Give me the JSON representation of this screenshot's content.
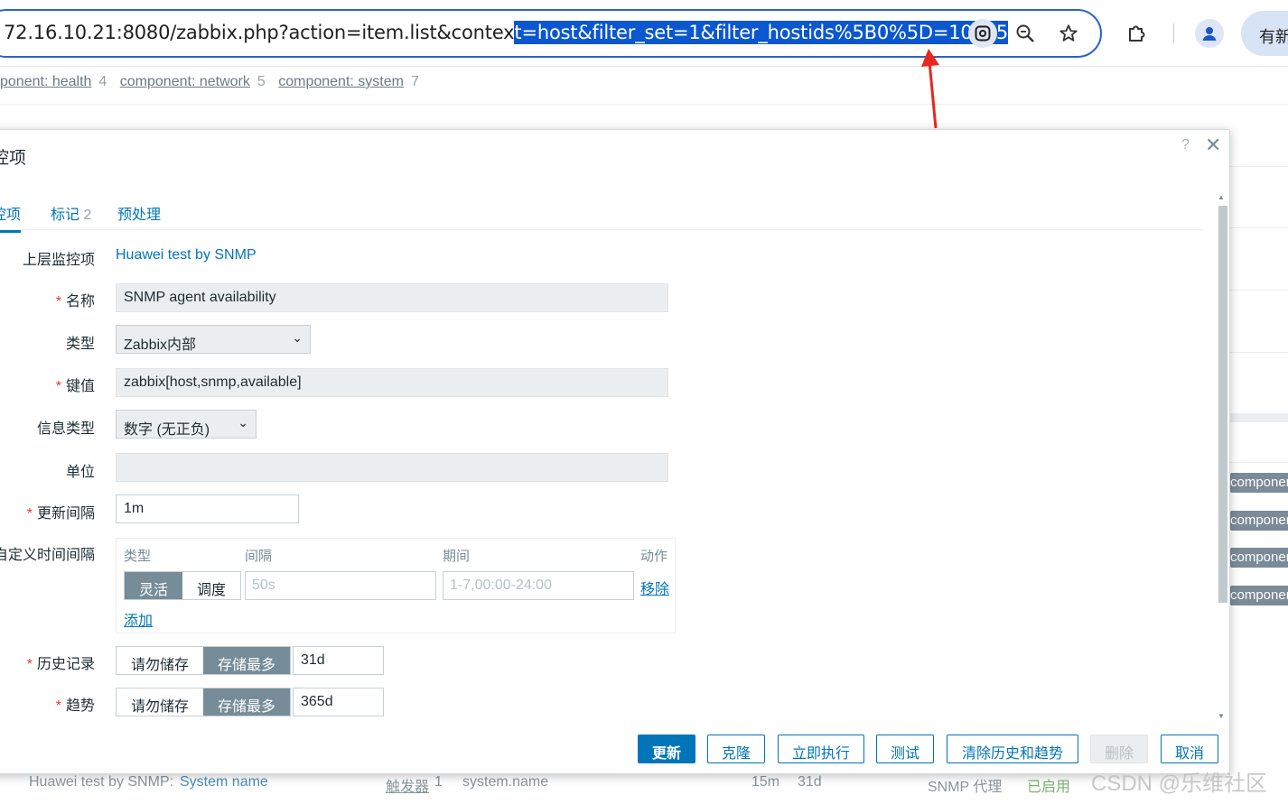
{
  "browser": {
    "url_prefix": "72.16.10.21:8080/zabbix.php?action=item.list&contex",
    "url_selected": "t=host&filter_set=1&filter_hostids%5B0%5D=10695",
    "new_label": "有新"
  },
  "background": {
    "tags": [
      {
        "label": "ponent: health",
        "count": "4"
      },
      {
        "label": "component: network",
        "count": "5"
      },
      {
        "label": "component: system",
        "count": "7"
      }
    ],
    "side_tag": "componen",
    "bottom_row": {
      "host": "Huawei test by SNMP:",
      "item": "System name",
      "triggers": "触发器",
      "trigger_count": "1",
      "key": "system.name",
      "interval": "15m",
      "history": "31d",
      "type": "SNMP 代理",
      "status": "已启用"
    }
  },
  "dialog": {
    "title": "控项",
    "help": "?",
    "close": "✕",
    "tabs": [
      {
        "label": "控项",
        "count": ""
      },
      {
        "label": "标记",
        "count": "2"
      },
      {
        "label": "预处理",
        "count": ""
      }
    ],
    "fields": {
      "parent_label": "上层监控项",
      "parent_value": "Huawei test by SNMP",
      "name_label": "名称",
      "name_value": "SNMP agent availability",
      "type_label": "类型",
      "type_value": "Zabbix内部",
      "key_label": "键值",
      "key_value": "zabbix[host,snmp,available]",
      "info_type_label": "信息类型",
      "info_type_value": "数字 (无正负)",
      "units_label": "单位",
      "units_value": "",
      "interval_label": "更新间隔",
      "interval_value": "1m",
      "custom_label": "自定义时间间隔",
      "history_label": "历史记录",
      "history_value": "31d",
      "trends_label": "趋势",
      "trends_value": "365d"
    },
    "custom_intervals": {
      "col_type": "类型",
      "col_interval": "间隔",
      "col_period": "期间",
      "col_action": "动作",
      "flexible": "灵活",
      "scheduling": "调度",
      "interval_placeholder": "50s",
      "period_placeholder": "1-7,00:00-24:00",
      "remove": "移除",
      "add": "添加"
    },
    "storage": {
      "do_not_store": "请勿储存",
      "store_up_to": "存储最多"
    },
    "buttons": {
      "update": "更新",
      "clone": "克隆",
      "execute_now": "立即执行",
      "test": "测试",
      "clear_history": "清除历史和趋势",
      "delete": "删除",
      "cancel": "取消"
    }
  },
  "watermark": "CSDN @乐维社区"
}
